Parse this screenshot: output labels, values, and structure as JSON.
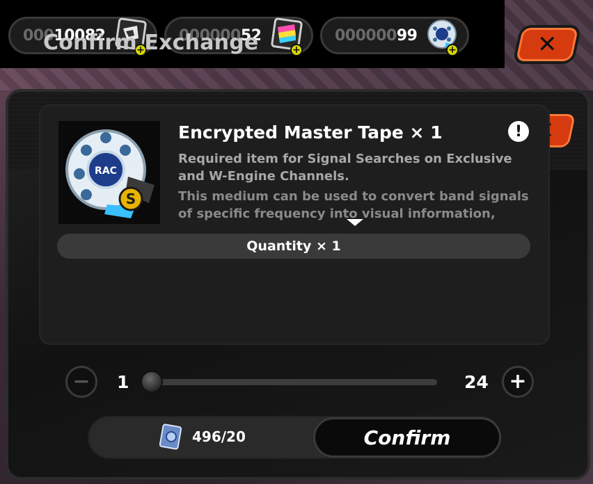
{
  "currencies": [
    {
      "dim": "000",
      "bright": "10082",
      "icon": "film-tape-icon"
    },
    {
      "dim": "000000",
      "bright": "52",
      "icon": "color-tape-icon"
    },
    {
      "dim": "000000",
      "bright": "99",
      "icon": "master-tape-icon"
    }
  ],
  "top_close": "✕",
  "dialog": {
    "title": "Confirm Exchange",
    "close": "✕",
    "item": {
      "title": "Encrypted Master Tape × 1",
      "desc1": "Required item for Signal Searches on Exclusive and W-Engine Channels.",
      "desc2": "This medium can be used to convert band signals of specific frequency into visual information, making the signal more visible...",
      "info": "!"
    },
    "quantity_label": "Quantity × 1",
    "slider": {
      "min": "1",
      "max": "24",
      "value": 1
    },
    "minus": "−",
    "plus": "+",
    "cost": "496/20",
    "confirm": "Confirm"
  },
  "colors": {
    "accent": "#d63b10",
    "badge": "#d8d800"
  }
}
